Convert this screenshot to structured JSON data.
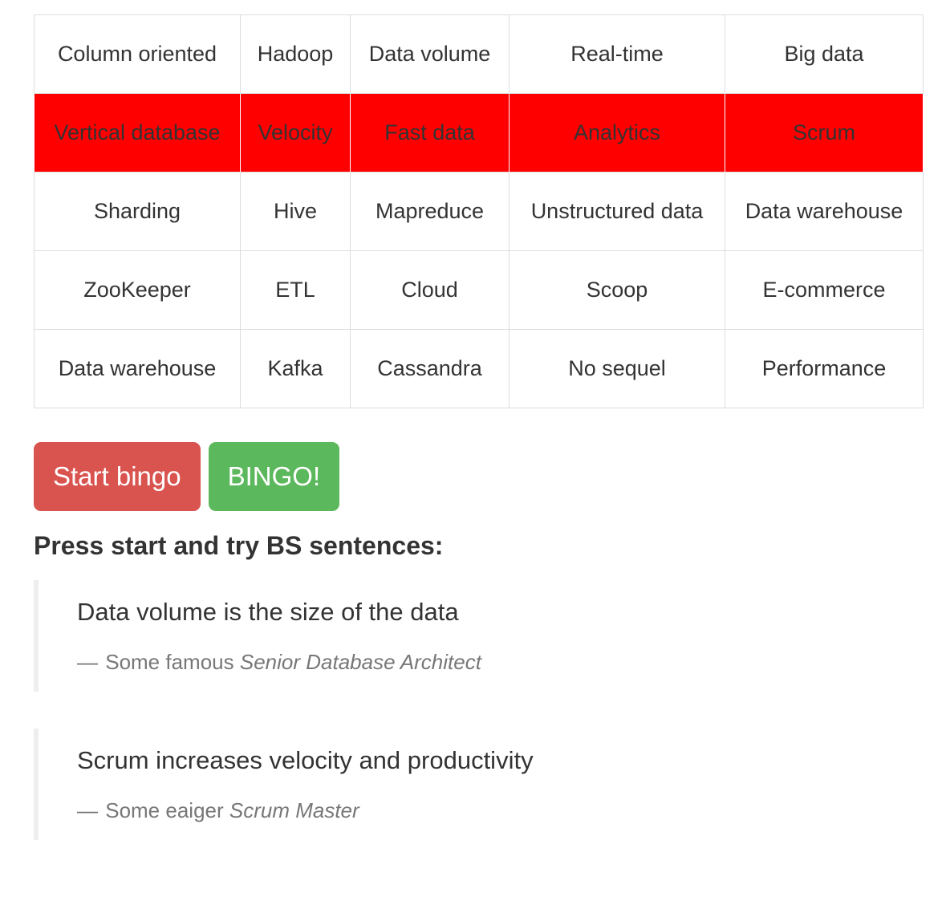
{
  "bingo": {
    "rows": [
      {
        "marked": false,
        "cells": [
          "Column oriented",
          "Hadoop",
          "Data volume",
          "Real-time",
          "Big data"
        ]
      },
      {
        "marked": true,
        "cells": [
          "Vertical database",
          "Velocity",
          "Fast data",
          "Analytics",
          "Scrum"
        ]
      },
      {
        "marked": false,
        "cells": [
          "Sharding",
          "Hive",
          "Mapreduce",
          "Unstructured data",
          "Data warehouse"
        ]
      },
      {
        "marked": false,
        "cells": [
          "ZooKeeper",
          "ETL",
          "Cloud",
          "Scoop",
          "E-commerce"
        ]
      },
      {
        "marked": false,
        "cells": [
          "Data warehouse",
          "Kafka",
          "Cassandra",
          "No sequel",
          "Performance"
        ]
      }
    ],
    "marked_color": "#ff0000",
    "border_color": "#dddddd"
  },
  "buttons": {
    "start_label": "Start bingo",
    "bingo_label": "BINGO!",
    "start_color": "#d9534f",
    "bingo_color": "#5cb85c"
  },
  "heading": "Press start and try BS sentences:",
  "quotes": [
    {
      "text": "Data volume is the size of the data",
      "dash": "—",
      "attribution": " Some famous ",
      "cite": "Senior Database Architect"
    },
    {
      "text": "Scrum increases velocity and productivity",
      "dash": "—",
      "attribution": " Some eaiger ",
      "cite": "Scrum Master"
    }
  ]
}
